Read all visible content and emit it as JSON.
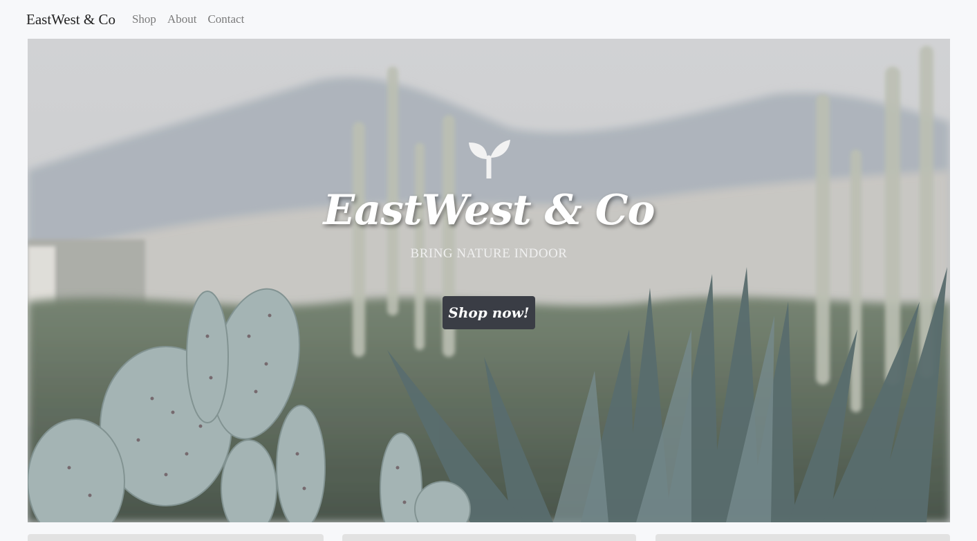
{
  "navbar": {
    "brand": "EastWest & Co",
    "links": [
      "Shop",
      "About",
      "Contact"
    ]
  },
  "hero": {
    "icon": "sprout-icon",
    "title": "EastWest & Co",
    "subtitle": "BRING NATURE INDOOR",
    "cta_label": "Shop now!",
    "cta_color": "#3a3d45"
  },
  "colors": {
    "page_bg": "#f7f8fa",
    "brand_text": "#222222",
    "nav_link": "#7a7a7a"
  }
}
